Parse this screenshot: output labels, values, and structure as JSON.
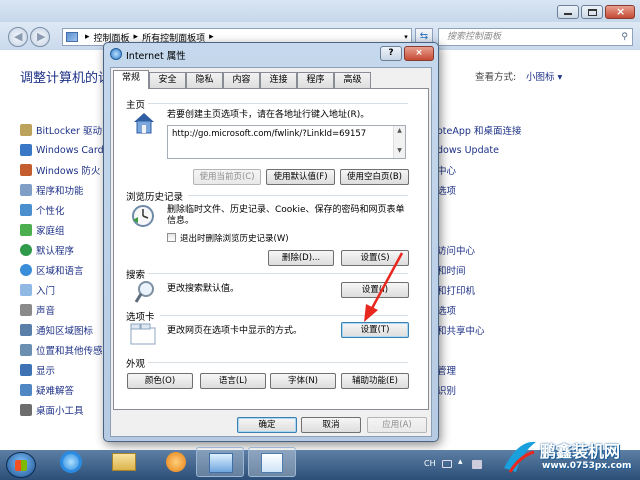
{
  "explorer": {
    "breadcrumb": [
      "控制面板",
      "所有控制面板项"
    ],
    "search_placeholder": "搜索控制面板",
    "heading": "调整计算机的设",
    "view_by_label": "查看方式:",
    "view_by_value": "小图标 ▾",
    "left_items": [
      "BitLocker 驱动",
      "Windows Card",
      "Windows 防火",
      "程序和功能",
      "个性化",
      "家庭组",
      "默认程序",
      "区域和语言",
      "入门",
      "声音",
      "通知区域图标",
      "位置和其他传感",
      "显示",
      "疑难解答",
      "桌面小工具"
    ],
    "right_items": [
      "oteApp 和桌面连接",
      "dows Update",
      "中心",
      "选项",
      "",
      "",
      "访问中心",
      "和时间",
      "和打印机",
      "选项",
      "和共享中心",
      "",
      "管理",
      "识别",
      ""
    ]
  },
  "dialog": {
    "title": "Internet 属性",
    "tabs": [
      "常规",
      "安全",
      "隐私",
      "内容",
      "连接",
      "程序",
      "高级"
    ],
    "home": {
      "section": "主页",
      "desc": "若要创建主页选项卡，请在各地址行键入地址(R)。",
      "url": "http://go.microsoft.com/fwlink/?LinkId=69157",
      "btn_current": "使用当前页(C)",
      "btn_default": "使用默认值(F)",
      "btn_blank": "使用空白页(B)"
    },
    "history": {
      "section": "浏览历史记录",
      "desc": "删除临时文件、历史记录、Cookie、保存的密码和网页表单信息。",
      "checkbox": "退出时删除浏览历史记录(W)",
      "btn_delete": "删除(D)...",
      "btn_settings": "设置(S)"
    },
    "search": {
      "section": "搜索",
      "desc": "更改搜索默认值。",
      "btn_settings": "设置(I)"
    },
    "tabs_section": {
      "section": "选项卡",
      "desc": "更改网页在选项卡中显示的方式。",
      "btn_settings": "设置(T)"
    },
    "appearance": {
      "section": "外观",
      "btn_colors": "颜色(O)",
      "btn_languages": "语言(L)",
      "btn_fonts": "字体(N)",
      "btn_accessibility": "辅助功能(E)"
    },
    "ok": "确定",
    "cancel": "取消",
    "apply": "应用(A)"
  },
  "taskbar": {
    "tray_text": "CH"
  },
  "watermark": {
    "brand": "鹏鑫装机网",
    "url": "www.0753px.com"
  },
  "colors": {
    "link": "#1e3287",
    "heading": "#1e3287",
    "arrow": "#e8281e"
  }
}
